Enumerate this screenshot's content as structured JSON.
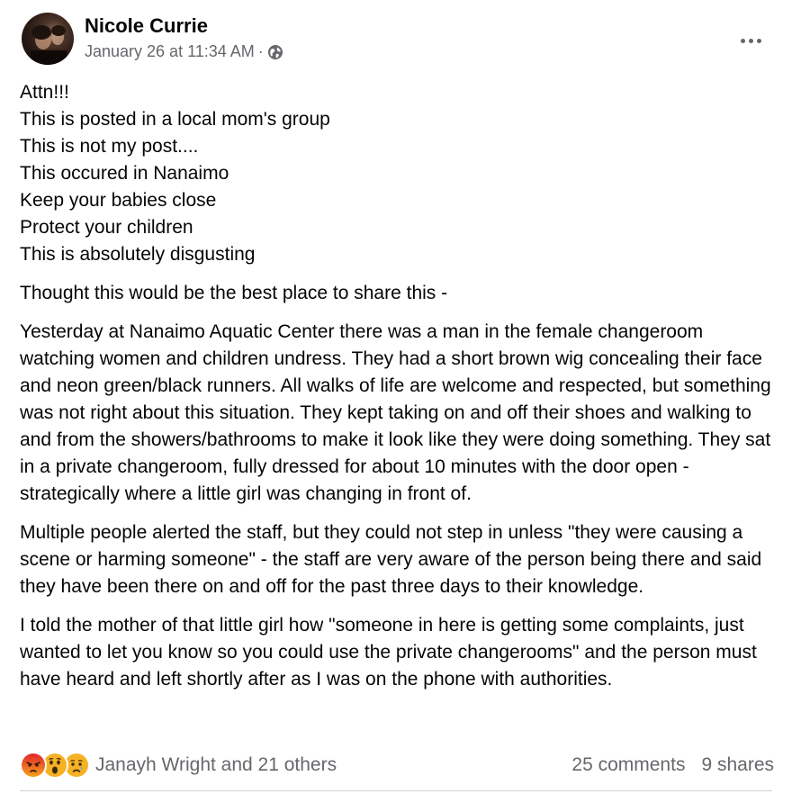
{
  "post": {
    "author": "Nicole Currie",
    "timestamp": "January 26 at 11:34 AM",
    "separator": "·",
    "privacy_icon": "globe-icon",
    "more_icon": "more-options-icon",
    "lines_group1": [
      "Attn!!!",
      "This is posted in a local mom's group",
      "This is not my post....",
      "This occured in Nanaimo",
      "Keep your babies close",
      "Protect your children",
      "This is absolutely disgusting"
    ],
    "paragraph2": "Thought this would be the best place to share this -",
    "paragraph3": "Yesterday at Nanaimo Aquatic Center there was a man in the female changeroom watching women and children undress. They had a short brown wig concealing their face and neon green/black runners. All walks of life are welcome and respected, but something was not right about this situation. They kept taking on and off their shoes and walking to and from the showers/bathrooms to make it look like they were doing something. They sat in a private changeroom, fully dressed for about 10 minutes with the door open - strategically where a little girl was changing in front of.",
    "paragraph4": "Multiple people alerted the staff, but they could not step in unless \"they were causing a scene or harming someone\" - the staff are very aware of the person being there and said they have been there on and off for the past three days to their knowledge.",
    "paragraph5": "I told the mother of that little girl how \"someone in here is getting some complaints, just wanted to let you know so you could use the private changerooms\" and the person must have heard and left shortly after as I was on the phone with authorities."
  },
  "footer": {
    "reaction_icons": [
      "angry-reaction-icon",
      "wow-reaction-icon",
      "sad-reaction-icon"
    ],
    "reactors": "Janayh Wright and 21 others",
    "comments": "25 comments",
    "shares": "9 shares"
  },
  "colors": {
    "text_primary": "#050505",
    "text_secondary": "#65676b",
    "angry": "#e9710f",
    "wow_sad": "#f7b125",
    "divider": "#ced0d4"
  }
}
